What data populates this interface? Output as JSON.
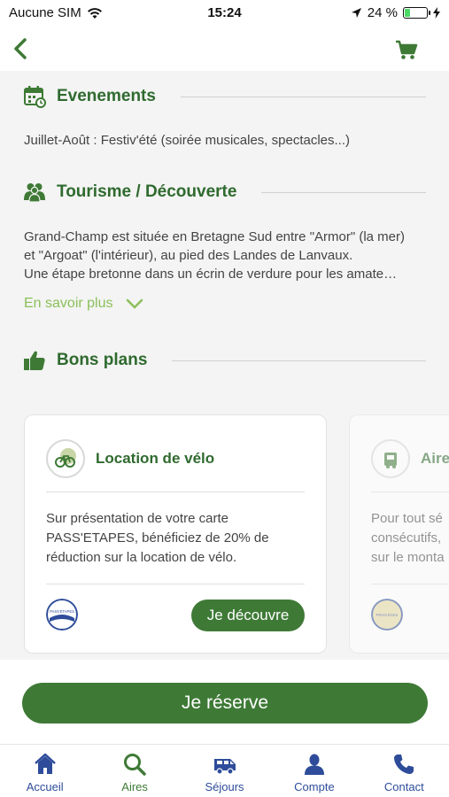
{
  "status_bar": {
    "carrier": "Aucune SIM",
    "time": "15:24",
    "battery": "24 %",
    "battery_level": 0.24
  },
  "colors": {
    "primary_green": "#3e7a36",
    "title_green": "#2f6a2f",
    "link_green": "#8cbf5b",
    "tab_blue": "#2e4c9a",
    "background": "#f3f4f3"
  },
  "header": {
    "back_icon": "chevron-left-icon",
    "cart_icon": "cart-icon"
  },
  "sections": {
    "events": {
      "title": "Evenements",
      "icon": "calendar-icon",
      "text": "Juillet-Août : Festiv'été (soirée musicales, spectacles...)"
    },
    "tourism": {
      "title": "Tourisme / Découverte",
      "icon": "people-icon",
      "line1": "Grand-Champ est située en Bretagne Sud entre \"Armor\" (la mer)",
      "line2": "et \"Argoat\" (l'intérieur), au pied des Landes de Lanvaux.",
      "line3": "Une étape bretonne dans un écrin de verdure pour les amate…",
      "more_label": "En savoir plus"
    },
    "deals": {
      "title": "Bons plans",
      "icon": "thumbs-up-icon"
    }
  },
  "cards": [
    {
      "title": "Location de vélo",
      "icon": "bike-icon",
      "desc_line1": "Sur présentation de votre carte",
      "desc_line2": "PASS'ETAPES, bénéficiez de 20% de",
      "desc_line3": "réduction sur la location de vélo.",
      "logo_text": "PASS'ETAPES",
      "button": "Je découvre"
    },
    {
      "title": "Aire",
      "icon": "camper-icon",
      "desc_line1": "Pour tout sé",
      "desc_line2": "consécutifs,",
      "desc_line3": "sur le monta",
      "logo_text": "PRIVILÈGES"
    }
  ],
  "reserve_button": "Je réserve",
  "tabs": [
    {
      "label": "Accueil",
      "icon": "home-icon"
    },
    {
      "label": "Aires",
      "icon": "search-icon"
    },
    {
      "label": "Séjours",
      "icon": "camper-van-icon"
    },
    {
      "label": "Compte",
      "icon": "user-icon"
    },
    {
      "label": "Contact",
      "icon": "phone-icon"
    }
  ]
}
